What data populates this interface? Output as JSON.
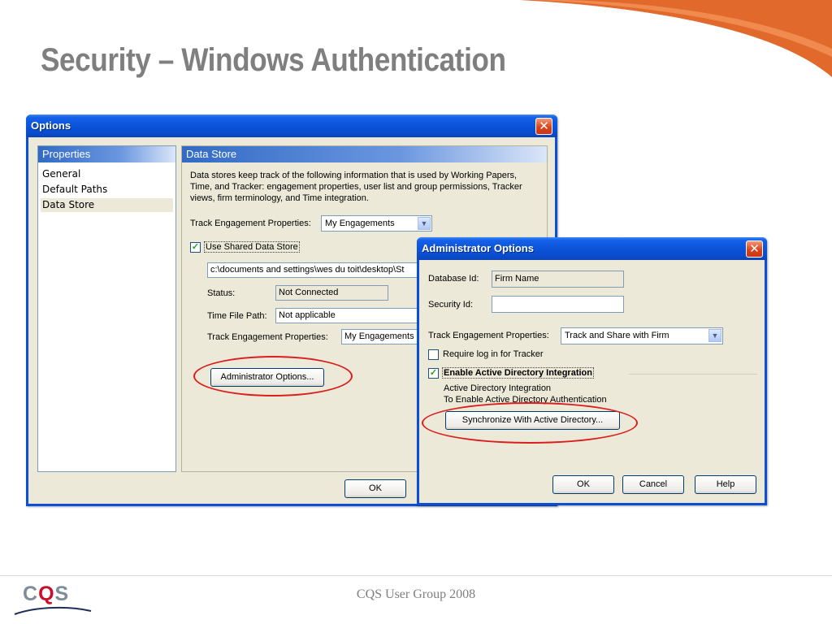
{
  "slide": {
    "title": "Security – Windows Authentication",
    "footer": "CQS User Group 2008",
    "logo": {
      "c": "C",
      "q": "Q",
      "s": "S"
    },
    "accent_color": "#e2692c"
  },
  "options_dialog": {
    "title": "Options",
    "close": "✕",
    "properties": {
      "header": "Properties",
      "items": [
        "General",
        "Default Paths",
        "Data Store"
      ],
      "selected": "Data Store"
    },
    "data_store": {
      "header": "Data Store",
      "description": "Data stores keep track of the following information that is used by Working Papers, Time, and Tracker: engagement properties, user list and group permissions, Tracker views, firm terminology, and Time integration.",
      "track_label": "Track Engagement Properties:",
      "track_value": "My Engagements",
      "use_shared_label": "Use Shared Data Store",
      "use_shared_checked": true,
      "path_value": "c:\\documents and settings\\wes du toit\\desktop\\St",
      "status_label": "Status:",
      "status_value": "Not Connected",
      "time_file_label": "Time File Path:",
      "time_file_value": "Not applicable",
      "track2_label": "Track Engagement Properties:",
      "track2_value": "My Engagements",
      "admin_button": "Administrator Options..."
    },
    "ok_button": "OK"
  },
  "admin_dialog": {
    "title": "Administrator Options",
    "close": "✕",
    "database_id_label": "Database Id:",
    "database_id_value": "Firm Name",
    "security_id_label": "Security Id:",
    "security_id_value": "",
    "track_label": "Track Engagement Properties:",
    "track_value": "Track and Share with Firm",
    "require_login_label": "Require log in for Tracker",
    "require_login_checked": false,
    "enable_ad_label": "Enable Active Directory Integration",
    "enable_ad_checked": true,
    "ad_line1": "Active Directory Integration",
    "ad_line2": "To Enable Active Directory Authentication",
    "sync_button": "Synchronize With Active Directory...",
    "ok_button": "OK",
    "cancel_button": "Cancel",
    "help_button": "Help"
  }
}
